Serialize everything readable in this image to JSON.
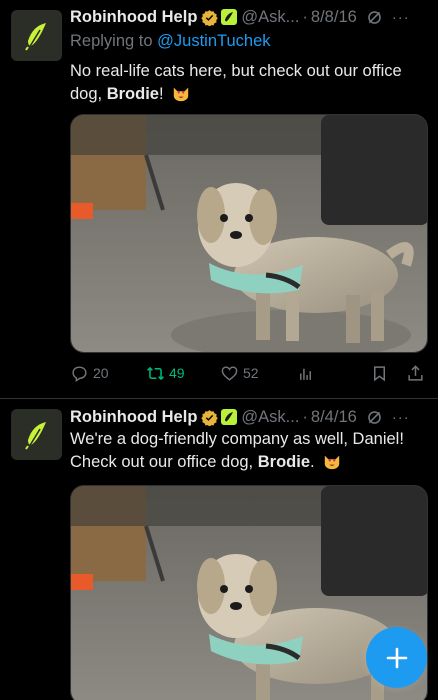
{
  "tweets": [
    {
      "display_name": "Robinhood Help",
      "handle": "@Ask...",
      "separator": "·",
      "date": "8/8/16",
      "replying_prefix": "Replying to ",
      "replying_to": "@JustinTuchek",
      "text_before": "No real-life cats here, but check out our office dog, ",
      "text_bold": "Brodie",
      "text_after": "!",
      "emoji": "heart-eyes-cat-emoji",
      "actions": {
        "replies": "20",
        "retweets": "49",
        "likes": "52"
      }
    },
    {
      "display_name": "Robinhood Help",
      "handle": "@Ask...",
      "separator": "·",
      "date": "8/4/16",
      "text_before": "We're a dog-friendly company as well, Daniel! Check out our office dog, ",
      "text_bold": "Brodie",
      "text_after": ".",
      "emoji": "heart-eyes-cat-emoji"
    }
  ],
  "colors": {
    "background": "#000000",
    "text": "#e7e9ea",
    "muted": "#71767b",
    "link": "#1d9bf0",
    "retweet_active": "#00ba7c",
    "brand_green": "#b9f13a",
    "verified_gold": "#e8b339"
  },
  "icons": {
    "avatar": "robinhood-feather-logo",
    "verified": "gold-verified-badge",
    "affiliate": "robinhood-affiliate-badge",
    "grok": "grok-icon",
    "more": "more-icon",
    "reply": "reply-icon",
    "retweet": "retweet-icon",
    "like": "heart-icon",
    "views": "views-icon",
    "bookmark": "bookmark-icon",
    "share": "share-icon",
    "compose": "plus-icon"
  }
}
